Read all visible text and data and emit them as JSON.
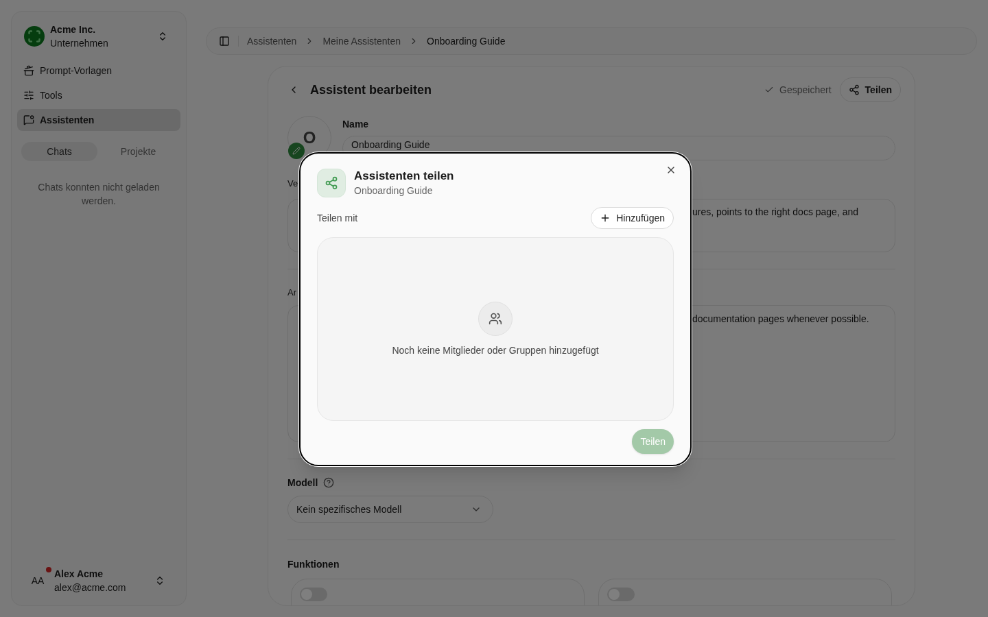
{
  "org": {
    "name": "Acme Inc.",
    "subtitle": "Unternehmen"
  },
  "nav": [
    {
      "label": "Prompt-Vorlagen",
      "kind": "templates",
      "selected": false
    },
    {
      "label": "Tools",
      "kind": "tools",
      "selected": false
    },
    {
      "label": "Assistenten",
      "kind": "assistants",
      "selected": true
    }
  ],
  "tabs": [
    {
      "label": "Chats",
      "selected": true
    },
    {
      "label": "Projekte",
      "selected": false
    }
  ],
  "chats_message": "Chats konnten nicht geladen werden.",
  "user": {
    "initials": "AA",
    "name": "Alex Acme",
    "email": "alex@acme.com",
    "notification": true
  },
  "breadcrumb": [
    "Assistenten",
    "Meine Assistenten",
    "Onboarding Guide"
  ],
  "editor": {
    "title": "Assistent bearbeiten",
    "saved_label": "Gespeichert",
    "share_label": "Teilen",
    "avatar_letter": "O",
    "name_label": "Name",
    "name_value": "Onboarding Guide",
    "description_label": "Ve",
    "description_value": "ures, points to the right docs page, and",
    "instructions_label": "Ar",
    "instructions_value": "documentation pages whenever possible.",
    "model_label": "Modell",
    "model_value": "Kein spezifisches Modell",
    "functions_label": "Funktionen",
    "functions": [
      {
        "on": false
      },
      {
        "on": false
      }
    ]
  },
  "dialog": {
    "title": "Assistenten teilen",
    "subtitle": "Onboarding Guide",
    "share_with_label": "Teilen mit",
    "add_label": "Hinzufügen",
    "empty_text": "Noch keine Mitglieder oder Gruppen hinzugefügt",
    "submit_label": "Teilen",
    "submit_disabled": true
  }
}
